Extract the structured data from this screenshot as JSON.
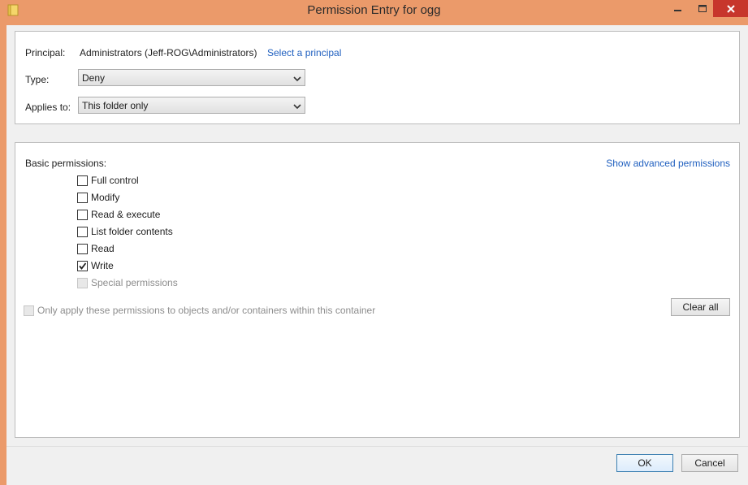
{
  "window": {
    "title": "Permission Entry for ogg",
    "icon": "folder-icon"
  },
  "principal": {
    "label": "Principal:",
    "value": "Administrators (Jeff-ROG\\Administrators)",
    "link": "Select a principal"
  },
  "type": {
    "label": "Type:",
    "value": "Deny"
  },
  "applies_to": {
    "label": "Applies to:",
    "value": "This folder only"
  },
  "permissions": {
    "label": "Basic permissions:",
    "advanced_link": "Show advanced permissions",
    "items": [
      {
        "label": "Full control",
        "checked": false,
        "disabled": false
      },
      {
        "label": "Modify",
        "checked": false,
        "disabled": false
      },
      {
        "label": "Read & execute",
        "checked": false,
        "disabled": false
      },
      {
        "label": "List folder contents",
        "checked": false,
        "disabled": false
      },
      {
        "label": "Read",
        "checked": false,
        "disabled": false
      },
      {
        "label": "Write",
        "checked": true,
        "disabled": false
      },
      {
        "label": "Special permissions",
        "checked": false,
        "disabled": true
      }
    ],
    "only_apply_label": "Only apply these permissions to objects and/or containers within this container",
    "clear_all": "Clear all"
  },
  "buttons": {
    "ok": "OK",
    "cancel": "Cancel"
  },
  "colors": {
    "titlebar": "#EB9A6A",
    "close_button": "#C7362C",
    "link": "#1f5fbf"
  }
}
